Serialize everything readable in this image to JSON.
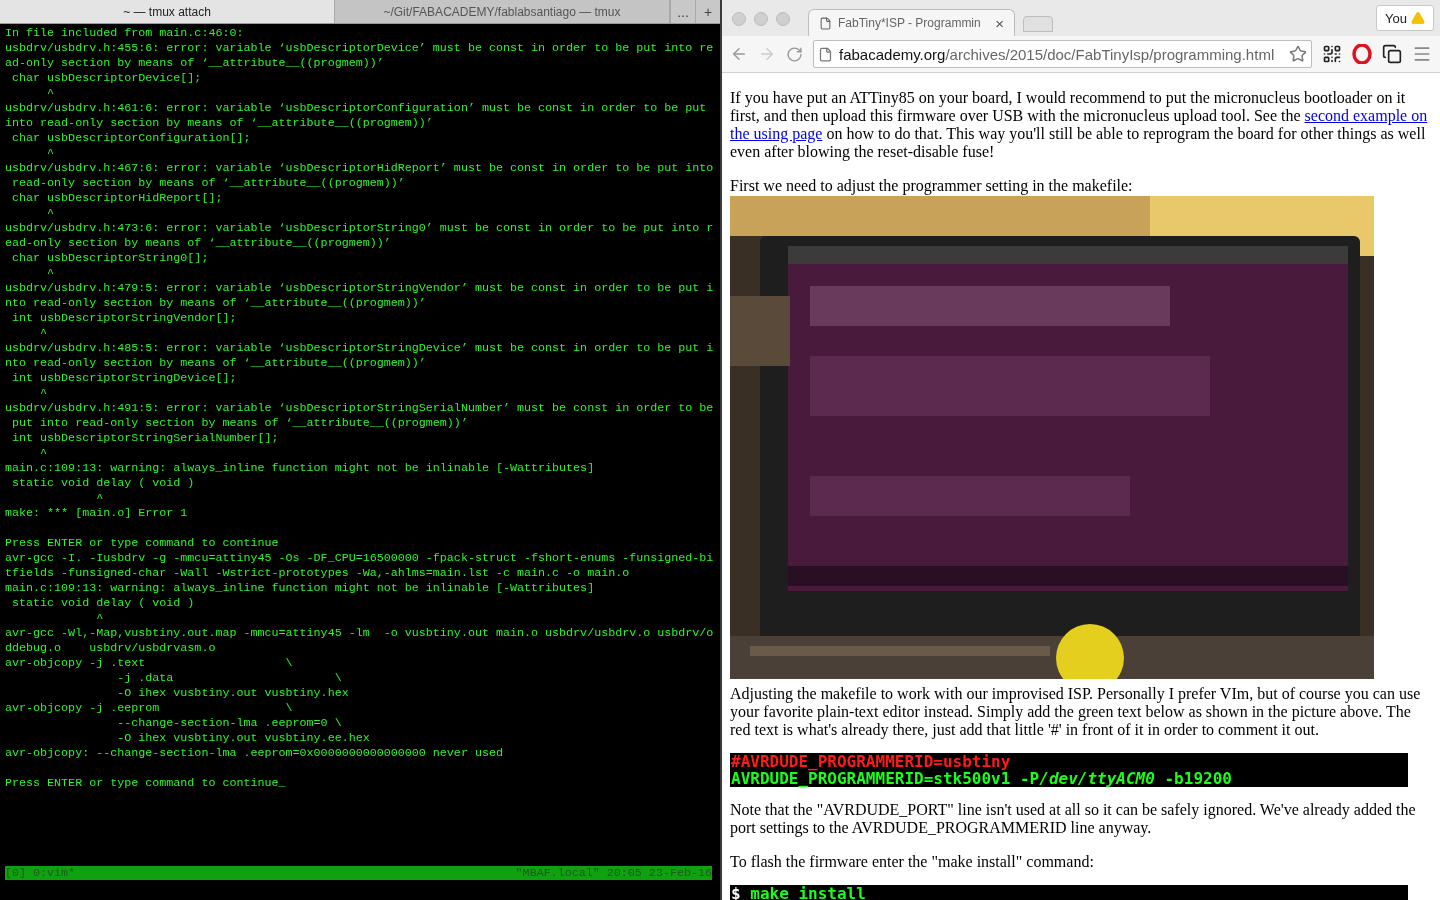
{
  "terminal": {
    "tabs": [
      {
        "label": "~ — tmux attach",
        "selected": true
      },
      {
        "label": "~/Git/FABACADEMY/fablabsantiago — tmux",
        "selected": false
      }
    ],
    "overflow": "...",
    "new_tab": "+",
    "output_blocks": [
      [
        "In file included from main.c:46:0:",
        "usbdrv/usbdrv.h:455:6: error: variable ‘usbDescriptorDevice’ must be const in order to be put into re",
        "ad-only section by means of ‘__attribute__((progmem))’",
        " char usbDescriptorDevice[];",
        "      ^",
        "usbdrv/usbdrv.h:461:6: error: variable ‘usbDescriptorConfiguration’ must be const in order to be put",
        "into read-only section by means of ‘__attribute__((progmem))’",
        " char usbDescriptorConfiguration[];",
        "      ^",
        "usbdrv/usbdrv.h:467:6: error: variable ‘usbDescriptorHidReport’ must be const in order to be put into",
        " read-only section by means of ‘__attribute__((progmem))’",
        " char usbDescriptorHidReport[];",
        "      ^",
        "usbdrv/usbdrv.h:473:6: error: variable ‘usbDescriptorString0’ must be const in order to be put into r",
        "ead-only section by means of ‘__attribute__((progmem))’",
        " char usbDescriptorString0[];",
        "      ^",
        "usbdrv/usbdrv.h:479:5: error: variable ‘usbDescriptorStringVendor’ must be const in order to be put i",
        "nto read-only section by means of ‘__attribute__((progmem))’",
        " int usbDescriptorStringVendor[];",
        "     ^",
        "usbdrv/usbdrv.h:485:5: error: variable ‘usbDescriptorStringDevice’ must be const in order to be put i",
        "nto read-only section by means of ‘__attribute__((progmem))’",
        " int usbDescriptorStringDevice[];",
        "     ^",
        "usbdrv/usbdrv.h:491:5: error: variable ‘usbDescriptorStringSerialNumber’ must be const in order to be",
        " put into read-only section by means of ‘__attribute__((progmem))’",
        " int usbDescriptorStringSerialNumber[];",
        "     ^",
        "main.c:109:13: warning: always_inline function might not be inlinable [-Wattributes]",
        " static void delay ( void )",
        "             ^",
        "make: *** [main.o] Error 1"
      ],
      [
        "Press ENTER or type command to continue",
        "avr-gcc -I. -Iusbdrv -g -mmcu=attiny45 -Os -DF_CPU=16500000 -fpack-struct -fshort-enums -funsigned-bi",
        "tfields -funsigned-char -Wall -Wstrict-prototypes -Wa,-ahlms=main.lst -c main.c -o main.o",
        "main.c:109:13: warning: always_inline function might not be inlinable [-Wattributes]",
        " static void delay ( void )",
        "             ^",
        "avr-gcc -Wl,-Map,vusbtiny.out.map -mmcu=attiny45 -lm  -o vusbtiny.out main.o usbdrv/usbdrv.o usbdrv/o",
        "ddebug.o    usbdrv/usbdrvasm.o",
        "avr-objcopy -j .text                    \\",
        "                -j .data                       \\",
        "                -O ihex vusbtiny.out vusbtiny.hex",
        "avr-objcopy -j .eeprom                  \\",
        "                --change-section-lma .eeprom=0 \\",
        "                -O ihex vusbtiny.out vusbtiny.ee.hex",
        "avr-objcopy: --change-section-lma .eeprom=0x0000000000000000 never used"
      ],
      [
        "Press ENTER or type command to continue_"
      ]
    ],
    "status_bar": {
      "left": "[0] 0:vim*",
      "right": "\"MBAF.local\" 20:05 23-Feb-16"
    }
  },
  "browser": {
    "tab": {
      "title": "FabTiny*ISP - Programmin",
      "close": "×"
    },
    "profile_button": "You",
    "address": {
      "host": "fabacademy.org",
      "path": "/archives/2015/doc/FabTinyIsp/programming.html"
    },
    "content": [
      {
        "kind": "paragraph",
        "segments": [
          {
            "text": "If you have put an ATTiny85 on your board, I would recommend to put the micronucleus bootloader on it first, and then upload this firmware over USB with the micronucleus upload tool. See the "
          },
          {
            "text": "second example on",
            "link": true
          },
          {
            "text": "the using page",
            "link": true
          },
          {
            "text": " on how to do that. This way you'll still be able to reprogram the board for other things as well even after blowing the reset-disable fuse!"
          }
        ]
      },
      {
        "kind": "paragraph",
        "segments": [
          {
            "text": "First we need to adjust the programmer setting in the makefile:"
          }
        ]
      },
      {
        "kind": "picture"
      },
      {
        "kind": "paragraph",
        "segments": [
          {
            "text": "Adjusting the makefile to work with our improvised ISP. Personally I prefer VIm, but of course you can use your favorite plain-text editor instead. Simply add the green text below as shown in the picture above. The red text is what's already there, just add that little '#' in front of it in order to comment it out."
          }
        ]
      },
      {
        "kind": "code",
        "lines": [
          {
            "segments": [
              {
                "text": "#AVRDUDE_PROGRAMMERID=usbtiny",
                "kind": "old"
              }
            ]
          },
          {
            "segments": [
              {
                "text": "AVRDUDE_PROGRAMMERID=stk500v1 -P",
                "kind": "new"
              },
              {
                "text": "/dev/ttyACM0",
                "kind": "new",
                "italic": true
              },
              {
                "text": " -b19200",
                "kind": "new"
              }
            ]
          }
        ]
      },
      {
        "kind": "paragraph",
        "segments": [
          {
            "text": "Note that the \"AVRDUDE_PORT\" line isn't used at all so it can be safely ignored. We've already added the port settings to the AVRDUDE_PROGRAMMERID line anyway."
          }
        ]
      },
      {
        "kind": "paragraph",
        "segments": [
          {
            "text": "To flash the firmware enter the \"make install\" command:"
          }
        ]
      },
      {
        "kind": "code",
        "lines": [
          {
            "segments": [
              {
                "text": "$",
                "kind": "prompt"
              },
              {
                "text": " make install",
                "kind": "new"
              }
            ]
          }
        ]
      }
    ]
  }
}
